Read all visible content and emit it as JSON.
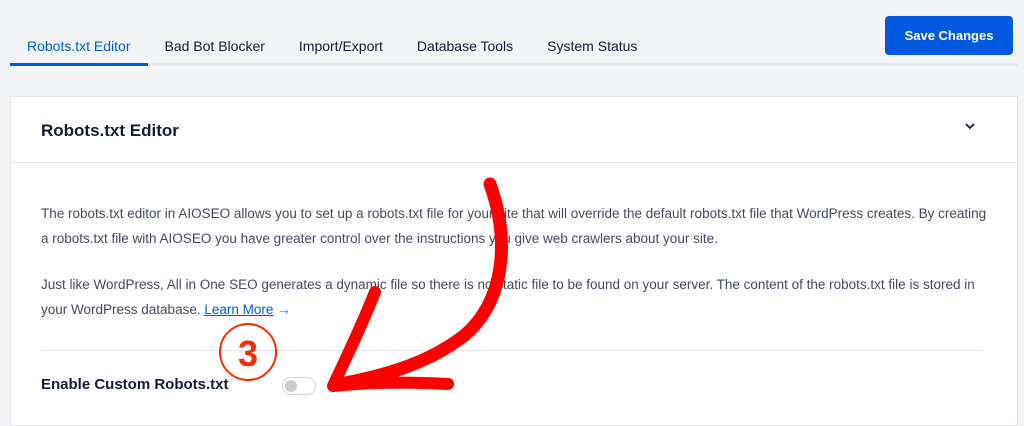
{
  "tabs": [
    "Robots.txt Editor",
    "Bad Bot Blocker",
    "Import/Export",
    "Database Tools",
    "System Status"
  ],
  "active_tab": "Robots.txt Editor",
  "save_label": "Save Changes",
  "card": {
    "title": "Robots.txt Editor",
    "para1": "The robots.txt editor in AIOSEO allows you to set up a robots.txt file for your site that will override the default robots.txt file that WordPress creates. By creating a robots.txt file with AIOSEO you have greater control over the instructions you give web crawlers about your site.",
    "para2": "Just like WordPress, All in One SEO generates a dynamic file so there is no static file to be found on your server. The content of the robots.txt file is stored in your WordPress database.",
    "learn_more": "Learn More",
    "learn_arrow": "→",
    "toggle_label": "Enable Custom Robots.txt",
    "toggle_on": false
  },
  "annotation": {
    "step": "3",
    "color": "#ff0000"
  },
  "colors": {
    "accent": "#005ae0",
    "background": "#f3f4f5"
  }
}
